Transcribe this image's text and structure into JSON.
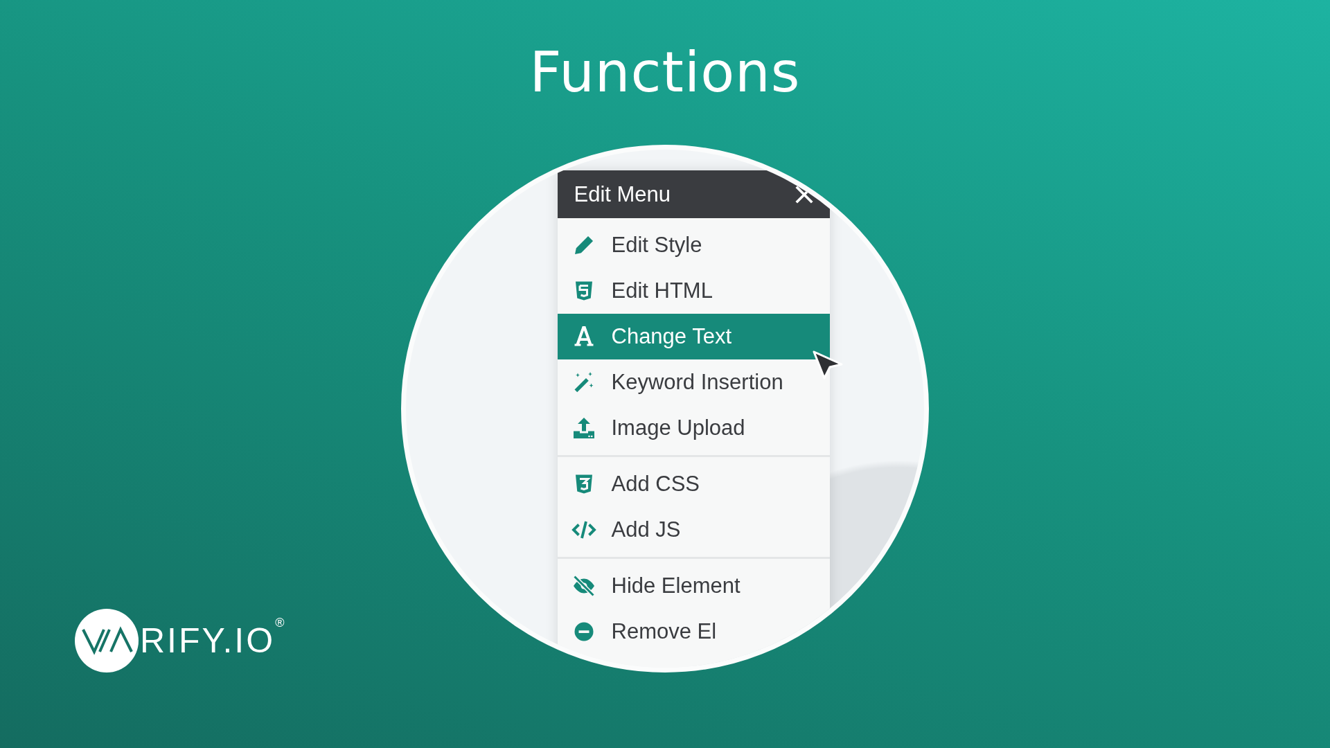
{
  "title": "Functions",
  "menu": {
    "title": "Edit Menu",
    "groups": [
      {
        "items": [
          {
            "label": "Edit Style",
            "kind": "pencil",
            "selected": false
          },
          {
            "label": "Edit HTML",
            "kind": "html5",
            "selected": false
          },
          {
            "label": "Change Text",
            "kind": "letter",
            "selected": true
          },
          {
            "label": "Keyword Insertion",
            "kind": "wand",
            "selected": false
          },
          {
            "label": "Image Upload",
            "kind": "upload",
            "selected": false
          }
        ]
      },
      {
        "items": [
          {
            "label": "Add CSS",
            "kind": "css3",
            "selected": false
          },
          {
            "label": "Add JS",
            "kind": "code",
            "selected": false
          }
        ]
      },
      {
        "items": [
          {
            "label": "Hide Element",
            "kind": "eye-off",
            "selected": false
          },
          {
            "label": "Remove El",
            "kind": "remove",
            "selected": false
          }
        ]
      }
    ]
  },
  "logo": {
    "text": "RIFY.IO",
    "registered": "®"
  }
}
